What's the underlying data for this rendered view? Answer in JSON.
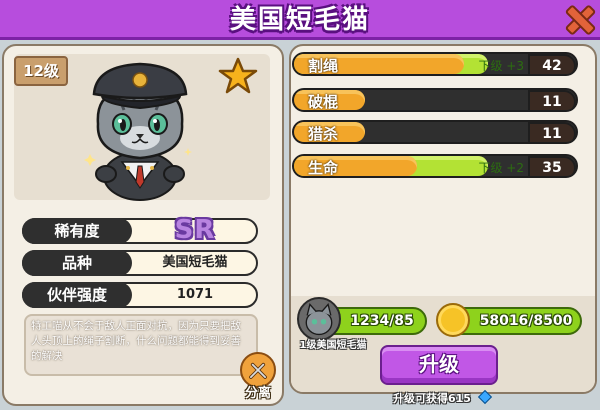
{
  "header": {
    "title": "美国短毛猫"
  },
  "character": {
    "level": "12级",
    "rarity_label": "稀有度",
    "rarity_value": "SR",
    "breed_label": "品种",
    "breed_value": "美国短毛猫",
    "power_label": "伙伴强度",
    "power_value": "1071",
    "description": "特工喵从不会于敌人正面对抗，因为只要把敌人头顶上的绳子割断，什么问题都能得到妥善的解决"
  },
  "separate_button": {
    "label": "分离"
  },
  "stats": [
    {
      "label": "割绳",
      "value": "42",
      "fill": 0.72,
      "bonus": "下级 +3",
      "upgrade_fill": 0.82
    },
    {
      "label": "破棍",
      "value": "11",
      "fill": 0.3
    },
    {
      "label": "猎杀",
      "value": "11",
      "fill": 0.3
    },
    {
      "label": "生命",
      "value": "35",
      "fill": 0.52,
      "bonus": "下级 +2",
      "upgrade_fill": 0.82
    }
  ],
  "resources": {
    "shards": "1234/85",
    "shard_name": "1级美国短毛猫",
    "coins": "58016/8500"
  },
  "upgrade": {
    "button_label": "升级",
    "hint": "升级可获得615"
  },
  "colors": {
    "header": "#b74ddd",
    "stat_fill": "#f2a62a",
    "stat_bonus_fill": "#b3e234",
    "resource_pill": "#8ed21c"
  }
}
